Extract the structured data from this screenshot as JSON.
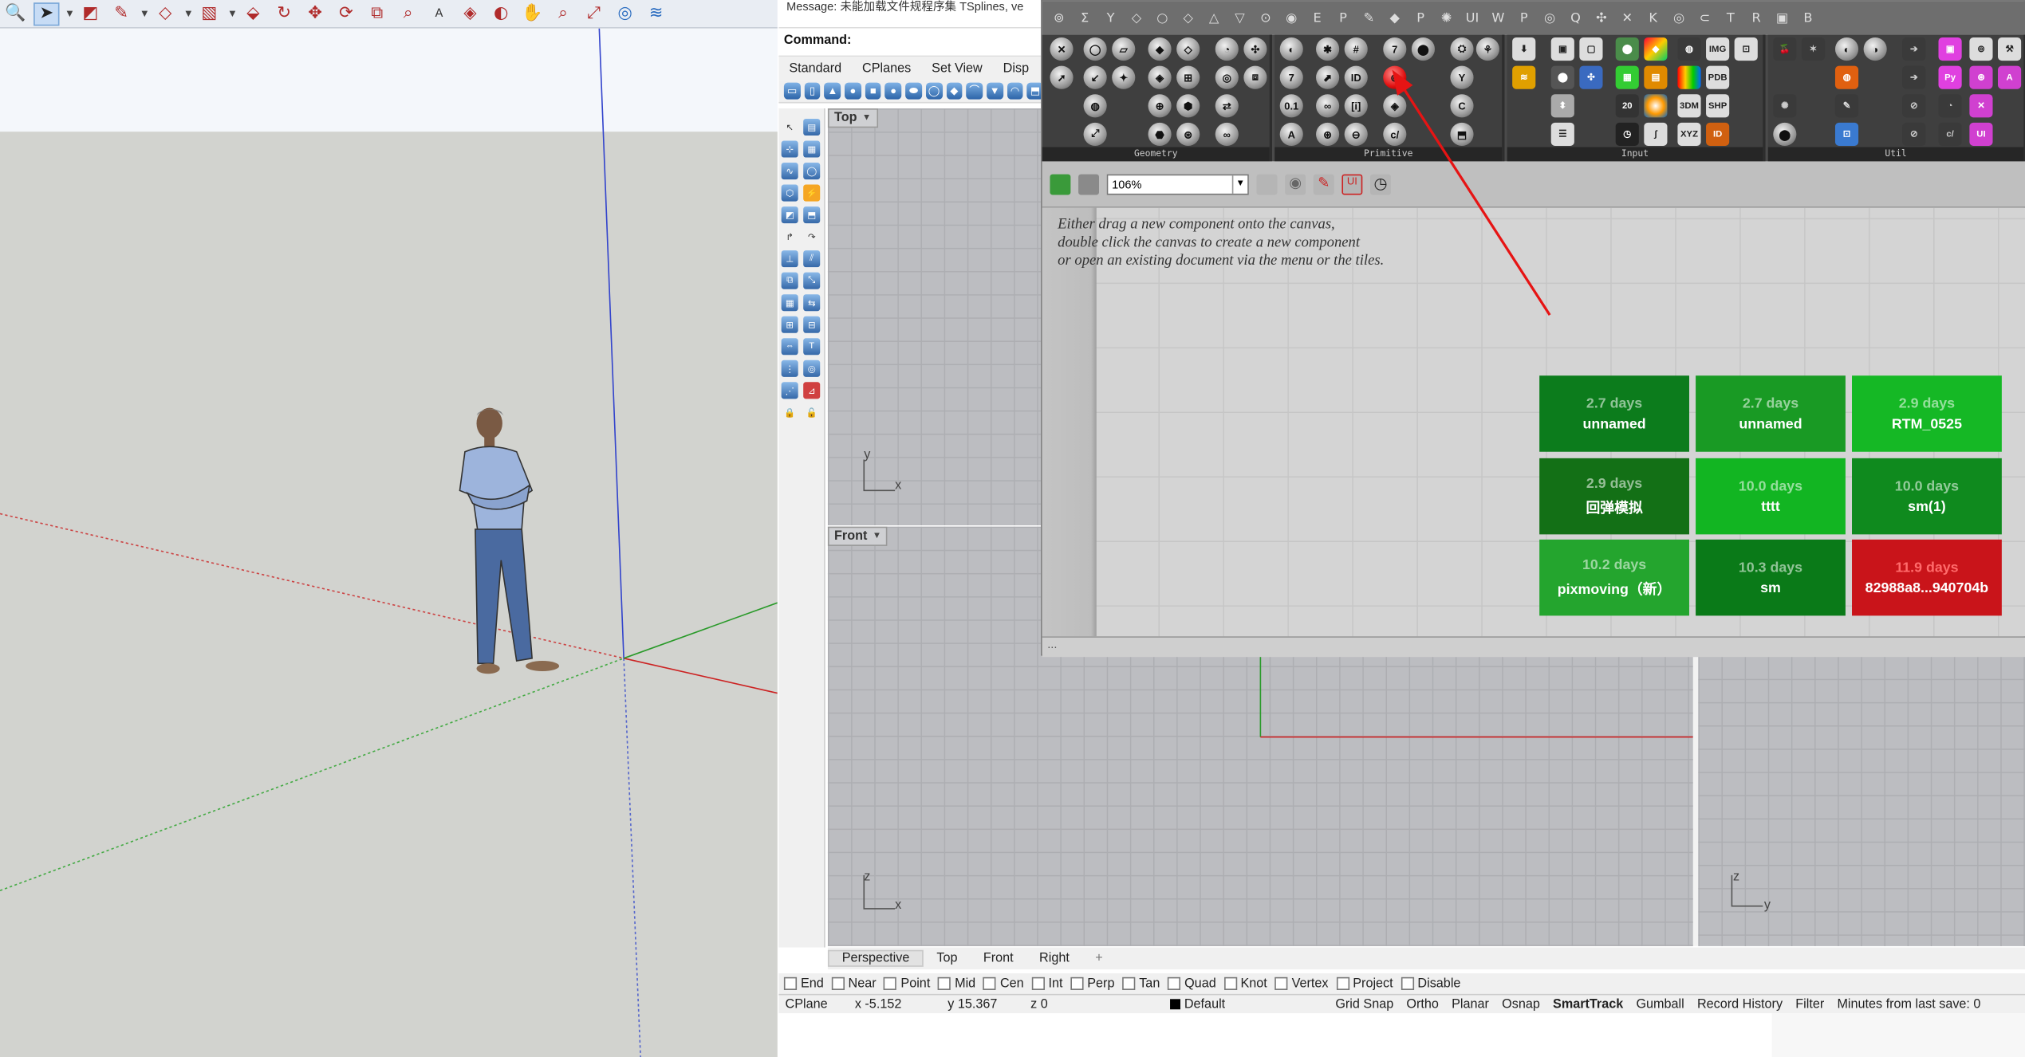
{
  "sketchup": {
    "toolbar_icons": [
      "zoom-icon",
      "select-arrow-icon",
      "eraser-icon",
      "pencil-icon",
      "shape-icon",
      "paint-icon",
      "push-pull-icon",
      "follow-me-icon",
      "move-icon",
      "rotate-icon",
      "offset-icon",
      "tape-measure-icon",
      "text-icon",
      "paint-bucket-icon",
      "orbit-icon",
      "pan-icon",
      "zoom-window-icon",
      "zoom-extents-icon",
      "geo-icon",
      "sandbox-icon"
    ]
  },
  "rhino": {
    "message": "Message: 未能加载文件规程序集 TSplines, ve",
    "command_label": "Command:",
    "toolbar_tabs": [
      "Standard",
      "CPlanes",
      "Set View",
      "Disp"
    ],
    "viewports": {
      "top": {
        "label": "Top",
        "axis_v": "y",
        "axis_h": "x"
      },
      "front": {
        "label": "Front",
        "axis_v": "z",
        "axis_h": "x"
      },
      "right": {
        "axis_v": "z",
        "axis_h": "y"
      }
    },
    "viewport_tabs": [
      "Perspective",
      "Top",
      "Front",
      "Right"
    ],
    "viewport_add": "+",
    "osnaps": [
      {
        "label": "End",
        "checked": false
      },
      {
        "label": "Near",
        "checked": false
      },
      {
        "label": "Point",
        "checked": false
      },
      {
        "label": "Mid",
        "checked": false
      },
      {
        "label": "Cen",
        "checked": false
      },
      {
        "label": "Int",
        "checked": false
      },
      {
        "label": "Perp",
        "checked": false
      },
      {
        "label": "Tan",
        "checked": false
      },
      {
        "label": "Quad",
        "checked": false
      },
      {
        "label": "Knot",
        "checked": false
      },
      {
        "label": "Vertex",
        "checked": false
      },
      {
        "label": "Project",
        "checked": false
      },
      {
        "label": "Disable",
        "checked": false
      }
    ],
    "status": {
      "cplane": "CPlane",
      "x": "x -5.152",
      "y": "y 15.367",
      "z": "z 0",
      "layer": "Default",
      "items": [
        "Grid Snap",
        "Ortho",
        "Planar",
        "Osnap",
        "SmartTrack",
        "Gumball",
        "Record History",
        "Filter",
        "Minutes from last save: 0"
      ]
    }
  },
  "grasshopper": {
    "tabs": [
      "⊚",
      "Σ",
      "Y",
      "◇",
      "○",
      "◇",
      "△",
      "▽",
      "⊙",
      "◉",
      "E",
      "P",
      "✎",
      "◆",
      "P",
      "✺",
      "UI",
      "W",
      "P",
      "◎",
      "Q",
      "✣",
      "✕",
      "K",
      "◎",
      "⊂",
      "T",
      "R",
      "▣",
      "B"
    ],
    "panels": [
      {
        "label": "Geometry"
      },
      {
        "label": "Primitive"
      },
      {
        "label": "Input"
      },
      {
        "label": "Util"
      }
    ],
    "zoom": "106%",
    "help_lines": [
      "Either drag a new component onto the canvas,",
      "double click the canvas to create a new component",
      "or open an existing document via the menu or the tiles."
    ],
    "bottom_text": "...",
    "tiles": [
      {
        "age": "2.7 days",
        "name": "unnamed",
        "color": "#0c7c1c"
      },
      {
        "age": "2.7 days",
        "name": "unnamed",
        "color": "#199a24"
      },
      {
        "age": "2.9 days",
        "name": "RTM_0525",
        "color": "#15b825"
      },
      {
        "age": "2.9 days",
        "name": "回弹模拟",
        "color": "#137016"
      },
      {
        "age": "10.0 days",
        "name": "tttt",
        "color": "#12b522"
      },
      {
        "age": "10.0 days",
        "name": "sm(1)",
        "color": "#0f8a1e"
      },
      {
        "age": "10.2 days",
        "name": "pixmoving（新）",
        "color": "#24a52e"
      },
      {
        "age": "10.3 days",
        "name": "sm",
        "color": "#0a7a18"
      },
      {
        "age": "11.9 days",
        "name": "82988a8...940704b",
        "color": "#c9141a"
      }
    ]
  }
}
